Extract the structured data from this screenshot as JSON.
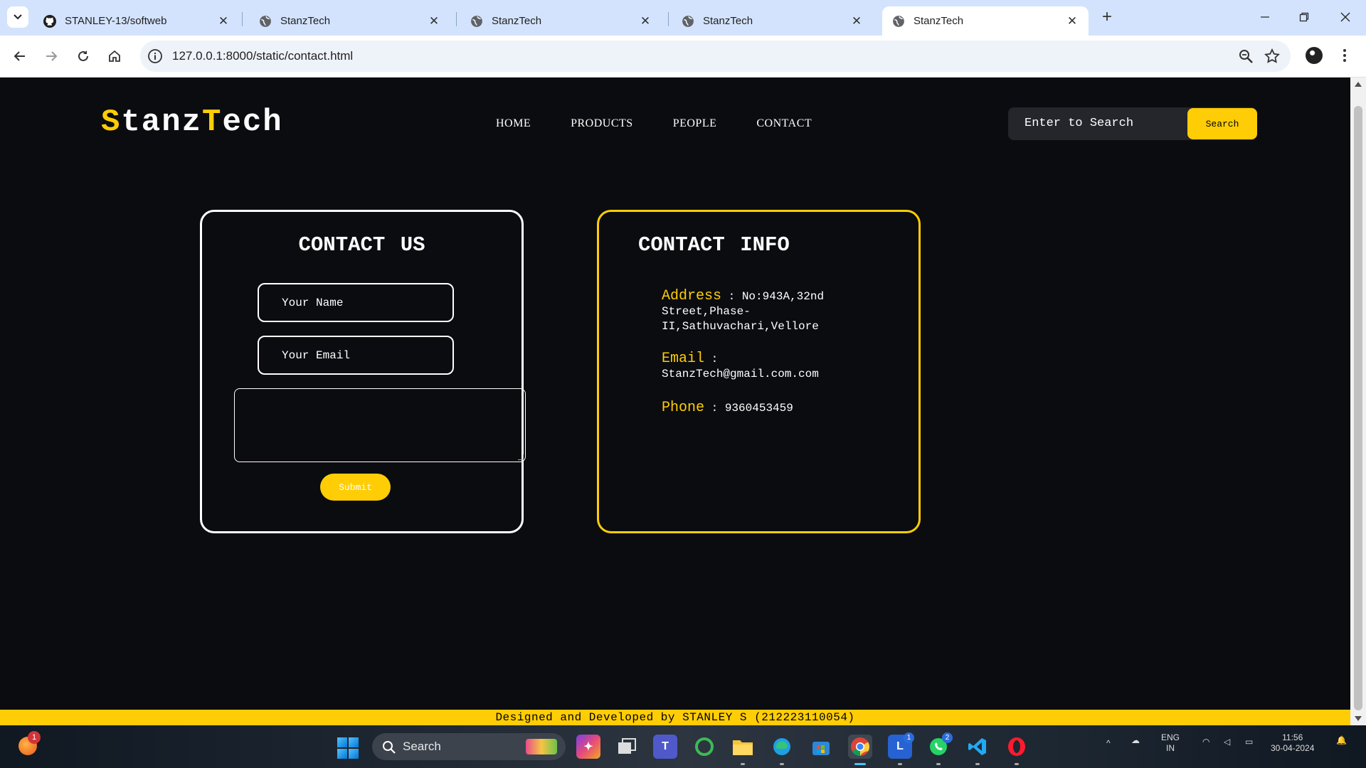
{
  "browser": {
    "tabs": [
      {
        "title": "STANLEY-13/softweb",
        "icon": "github-icon",
        "active": false
      },
      {
        "title": "StanzTech",
        "icon": "globe-icon",
        "active": false
      },
      {
        "title": "StanzTech",
        "icon": "globe-icon",
        "active": false
      },
      {
        "title": "StanzTech",
        "icon": "globe-icon",
        "active": false
      },
      {
        "title": "StanzTech",
        "icon": "globe-icon",
        "active": true
      }
    ],
    "url": "127.0.0.1:8000/static/contact.html"
  },
  "site": {
    "logo": {
      "part1": "S",
      "part2": "tanz",
      "part3": "T",
      "part4": "ech"
    },
    "nav": [
      "HOME",
      "PRODUCTS",
      "PEOPLE",
      "CONTACT"
    ],
    "search": {
      "placeholder": "Enter to Search",
      "button": "Search"
    },
    "colors": {
      "accent": "#ffcd05",
      "background": "#0b0c10"
    }
  },
  "contact_form": {
    "title": "CONTACT US",
    "name_placeholder": "Your Name",
    "email_placeholder": "Your Email",
    "message_value": "",
    "submit_label": "Submit"
  },
  "contact_info": {
    "title": "CONTACT INFO",
    "address_label": "Address",
    "address_value": ": No:943A,32nd Street,Phase-II,Sathuvachari,Vellore",
    "email_label": "Email",
    "email_value": ":",
    "email_address": "StanzTech@gmail.com.com",
    "phone_label": "Phone",
    "phone_value": ": 9360453459"
  },
  "footer": {
    "text": "Designed and Developed by STANLEY S (212223110054)"
  },
  "taskbar": {
    "search_label": "Search",
    "badges": {
      "left_app": "1",
      "l_app": "1",
      "whatsapp": "2"
    },
    "tray": {
      "lang1": "ENG",
      "lang2": "IN",
      "time": "11:56",
      "date": "30-04-2024"
    }
  }
}
